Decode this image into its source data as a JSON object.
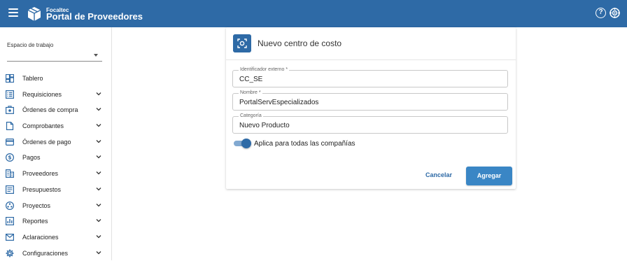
{
  "header": {
    "brand_small": "Focaltec",
    "brand_title": "Portal de Proveedores",
    "help_glyph": "?",
    "icons": [
      "menu-icon",
      "box-logo-icon",
      "help-icon",
      "target-icon"
    ],
    "color": "#2e6aa6"
  },
  "sidebar": {
    "workspace_label": "Espacio de trabajo",
    "workspace_value": "",
    "items": [
      {
        "label": "Tablero",
        "icon": "dashboard-icon",
        "expandable": false
      },
      {
        "label": "Requisiciones",
        "icon": "list-icon",
        "expandable": true
      },
      {
        "label": "Órdenes de compra",
        "icon": "purchase-order-icon",
        "expandable": true
      },
      {
        "label": "Comprobantes",
        "icon": "document-icon",
        "expandable": true
      },
      {
        "label": "Órdenes de pago",
        "icon": "credit-card-icon",
        "expandable": true
      },
      {
        "label": "Pagos",
        "icon": "dollar-icon",
        "expandable": true
      },
      {
        "label": "Proveedores",
        "icon": "building-icon",
        "expandable": true
      },
      {
        "label": "Presupuestos",
        "icon": "budget-icon",
        "expandable": true
      },
      {
        "label": "Proyectos",
        "icon": "project-icon",
        "expandable": true
      },
      {
        "label": "Reportes",
        "icon": "report-icon",
        "expandable": true
      },
      {
        "label": "Aclaraciones",
        "icon": "mail-icon",
        "expandable": true
      },
      {
        "label": "Configuraciones",
        "icon": "gear-icon",
        "expandable": true
      }
    ]
  },
  "dialog": {
    "title": "Nuevo centro de costo",
    "icon": "scan-icon",
    "fields": [
      {
        "label": "Identificador externo *",
        "value": "CC_SE"
      },
      {
        "label": "Nombre *",
        "value": "PortalServEspecializados"
      },
      {
        "label": "Categoría",
        "value": "Nuevo Producto"
      }
    ],
    "toggle": {
      "label": "Aplica para todas las compañías",
      "on": true
    },
    "cancel_label": "Cancelar",
    "add_label": "Agregar"
  }
}
